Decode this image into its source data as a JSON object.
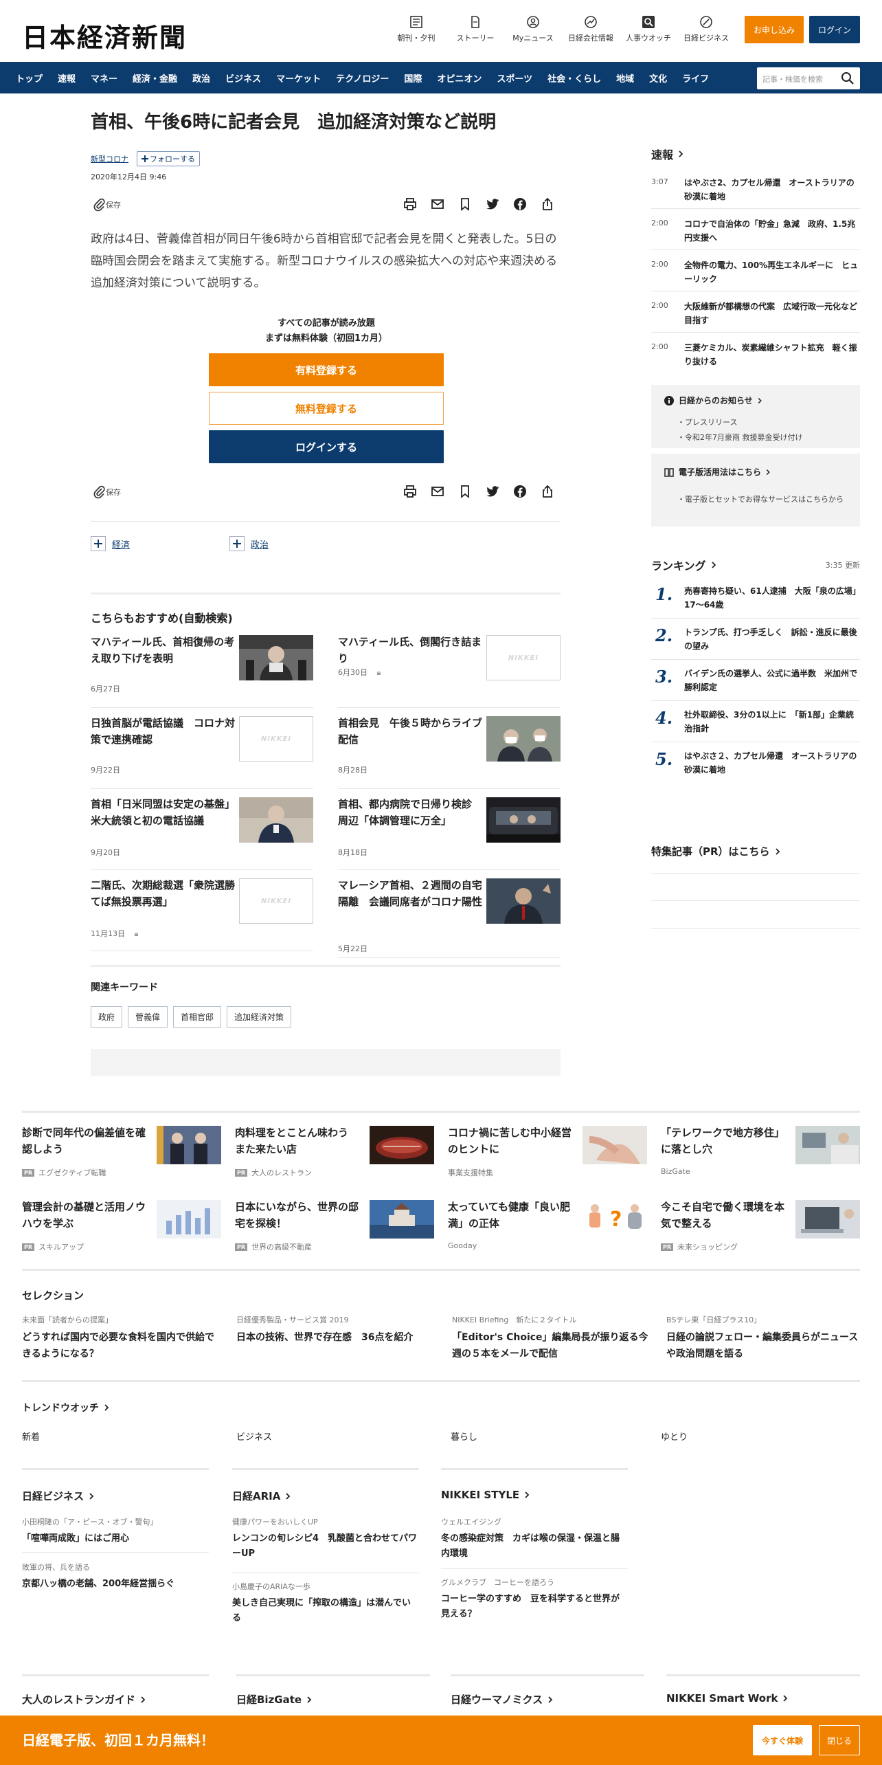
{
  "header": {
    "logo": "日本経済新聞",
    "icons": [
      {
        "label": "朝刊・夕刊",
        "icon": "newspaper-icon"
      },
      {
        "label": "ストーリー",
        "icon": "document-icon"
      },
      {
        "label": "Myニュース",
        "icon": "user-icon"
      },
      {
        "label": "日経会社情報",
        "icon": "chart-icon"
      },
      {
        "label": "人事ウオッチ",
        "icon": "search-person-icon"
      },
      {
        "label": "日経ビジネス",
        "icon": "compass-icon"
      }
    ],
    "subscribe": "お申し込み",
    "login": "ログイン"
  },
  "nav": {
    "items": [
      "トップ",
      "速報",
      "マネー",
      "経済・金融",
      "政治",
      "ビジネス",
      "マーケット",
      "テクノロジー",
      "国際",
      "オピニオン",
      "スポーツ",
      "社会・くらし",
      "地域",
      "文化",
      "ライフ"
    ],
    "search_placeholder": "記事・株価を検索"
  },
  "article": {
    "title": "首相、午後6時に記者会見　追加経済対策など説明",
    "tag": "新型コロナ",
    "follow": "フォローする",
    "date": "2020年12月4日 9:46",
    "save": "保存",
    "lead": "政府は4日、菅義偉首相が同日午後6時から首相官邸で記者会見を開くと発表した。5日の臨時国会閉会を踏まえて実施する。新型コロナウイルスの感染拡大への対応や来週決める追加経済対策について説明する。",
    "paywall": {
      "line1": "すべての記事が読み放題",
      "line2": "まずは無料体験（初回1カ月）",
      "paid": "有料登録する",
      "free": "無料登録する",
      "login": "ログインする"
    },
    "topics": [
      "経済",
      "政治"
    ]
  },
  "recommend": {
    "heading": "こちらもおすすめ(自動検索)",
    "items": [
      {
        "title": "マハティール氏、首相復帰の考え取り下げを表明",
        "date": "6月27日",
        "lock": false,
        "img": "photo"
      },
      {
        "title": "マハティール氏、倒閣行き詰まり",
        "date": "6月30日",
        "lock": true,
        "img": "nikkei"
      },
      {
        "title": "日独首脳が電話協議　コロナ対策で連携確認",
        "date": "9月22日",
        "lock": false,
        "img": "nikkei"
      },
      {
        "title": "首相会見　午後５時からライブ配信",
        "date": "8月28日",
        "lock": false,
        "img": "photo"
      },
      {
        "title": "首相「日米同盟は安定の基盤」　米大統領と初の電話協議",
        "date": "9月20日",
        "lock": false,
        "img": "photo"
      },
      {
        "title": "首相、都内病院で日帰り検診　周辺「体調管理に万全」",
        "date": "8月18日",
        "lock": false,
        "img": "photo"
      },
      {
        "title": "二階氏、次期総裁選「衆院選勝てば無投票再選」",
        "date": "11月13日",
        "lock": true,
        "img": "nikkei"
      },
      {
        "title": "マレーシア首相、２週間の自宅隔離　会議同席者がコロナ陽性",
        "date": "5月22日",
        "lock": false,
        "img": "photo"
      }
    ],
    "placeholder_label": "NIKKEI"
  },
  "keywords": {
    "heading": "関連キーワード",
    "items": [
      "政府",
      "菅義偉",
      "首相官邸",
      "追加経済対策"
    ]
  },
  "sidebar": {
    "breaking": {
      "heading": "速報",
      "items": [
        {
          "time": "3:07",
          "text": "はやぶさ2、カプセル帰還　オーストラリアの砂漠に着地"
        },
        {
          "time": "2:00",
          "text": "コロナで自治体の「貯金」急減　政府、1.5兆円支援へ"
        },
        {
          "time": "2:00",
          "text": "全物件の電力、100%再生エネルギーに　ヒューリック"
        },
        {
          "time": "2:00",
          "text": "大阪維新が都構想の代案　広域行政一元化など目指す"
        },
        {
          "time": "2:00",
          "text": "三菱ケミカル、炭素繊維シャフト拡充　軽く振り抜ける"
        }
      ]
    },
    "notice": {
      "heading": "日経からのお知らせ",
      "links": [
        "プレスリリース",
        "令和2年7月豪雨 救援募金受け付け"
      ],
      "heading2": "電子版活用法はこちら",
      "links2": [
        "電子版とセットでお得なサービスはこちらから"
      ]
    },
    "ranking": {
      "heading": "ランキング",
      "updated": "3:35  更新",
      "items": [
        {
          "rank": "1.",
          "text": "売春寄持ち疑い、61人逮捕　大阪「泉の広場」17～64歳"
        },
        {
          "rank": "2.",
          "text": "トランプ氏、打つ手乏しく　訴訟・進反に最後の望み"
        },
        {
          "rank": "3.",
          "text": "バイデン氏の選挙人、公式に過半数　米加州で勝利認定"
        },
        {
          "rank": "4.",
          "text": "社外取締役、3分の1以上に　「新1部」企業統治指針"
        },
        {
          "rank": "5.",
          "text": "はやぶさ２、カプセル帰還　オーストラリアの砂漠に着地"
        }
      ]
    },
    "pr_heading": "特集記事（PR）はこちら"
  },
  "pr": {
    "badge": "PR",
    "items": [
      {
        "title": "診断で同年代の偏差値を確認しよう",
        "source": "エグゼクティブ転職",
        "pr": true,
        "img": "people"
      },
      {
        "title": "肉料理をとことん味わう　また来たい店",
        "source": "大人のレストラン",
        "pr": true,
        "img": "meat"
      },
      {
        "title": "コロナ禍に苦しむ中小経営のヒントに",
        "source": "事業支援特集",
        "pr": false,
        "img": "hands"
      },
      {
        "title": "「テレワークで地方移住」に落とし穴",
        "source": "BizGate",
        "pr": false,
        "img": "desk"
      },
      {
        "title": "管理会計の基礎と活用ノウハウを学ぶ",
        "source": "スキルアップ",
        "pr": true,
        "img": "chart"
      },
      {
        "title": "日本にいながら、世界の邸宅を探検！",
        "source": "世界の高級不動産",
        "pr": true,
        "img": "castle"
      },
      {
        "title": "太っていても健康「良い肥満」の正体",
        "source": "Gooday",
        "pr": false,
        "img": "body"
      },
      {
        "title": "今こそ自宅で働く環境を本気で整える",
        "source": "未来ショッピング",
        "pr": true,
        "img": "laptop"
      }
    ]
  },
  "selection": {
    "heading": "セレクション",
    "items": [
      {
        "sub": "未来面「読者からの提案」",
        "title": "どうすれば国内で必要な食料を国内で供給できるようになる？"
      },
      {
        "sub": "日経優秀製品・サービス賞 2019",
        "title": "日本の技術、世界で存在感　36点を紹介"
      },
      {
        "sub": "NIKKEI Briefing　新たに２タイトル",
        "title": "「Editor's Choice」編集局長が振り返る今週の５本をメールで配信"
      },
      {
        "sub": "BSテレ東「日経プラス10」",
        "title": "日経の論説フェロー・編集委員らがニュースや政治問題を語る"
      }
    ]
  },
  "trend": {
    "heading": "トレンドウオッチ",
    "cats": [
      "新着",
      "ビジネス",
      "暮らし",
      "ゆとり"
    ]
  },
  "columns": [
    {
      "heading": "日経ビジネス",
      "articles": [
        {
          "sub": "小田桐隆の「ア・ピース・オブ・警句」",
          "title": "「喧嘩両成敗」にはご用心"
        },
        {
          "sub": "敗軍の将、兵を語る",
          "title": "京都八ッ橋の老舗、200年経営揺らぐ"
        }
      ]
    },
    {
      "heading": "日経ARIA",
      "articles": [
        {
          "sub": "健康パワーをおいしくUP",
          "title": "レンコンの旬レシピ4　乳酸菌と合わせてパワーUP"
        },
        {
          "sub": "小島慶子のARIAな一歩",
          "title": "美しき自己実現に「搾取の構造」は潜んでいる"
        }
      ]
    },
    {
      "heading": "NIKKEI STYLE",
      "articles": [
        {
          "sub": "ウェルエイジング",
          "title": "冬の感染症対策　カギは喉の保湿・保温と腸内環境"
        },
        {
          "sub": "グルメクラブ　コーヒーを語ろう",
          "title": "コーヒー学のすすめ　豆を科学すると世界が見える？"
        }
      ]
    }
  ],
  "bottom": [
    "大人のレストランガイド",
    "日経BizGate",
    "日経ウーマノミクス",
    "NIKKEI Smart Work"
  ],
  "banner": {
    "text": "日経電子版、初回１カ月無料！",
    "trial": "今すぐ体験",
    "close": "閉じる"
  },
  "colors": {
    "navy": "#0c3b6e",
    "orange": "#f08200"
  }
}
